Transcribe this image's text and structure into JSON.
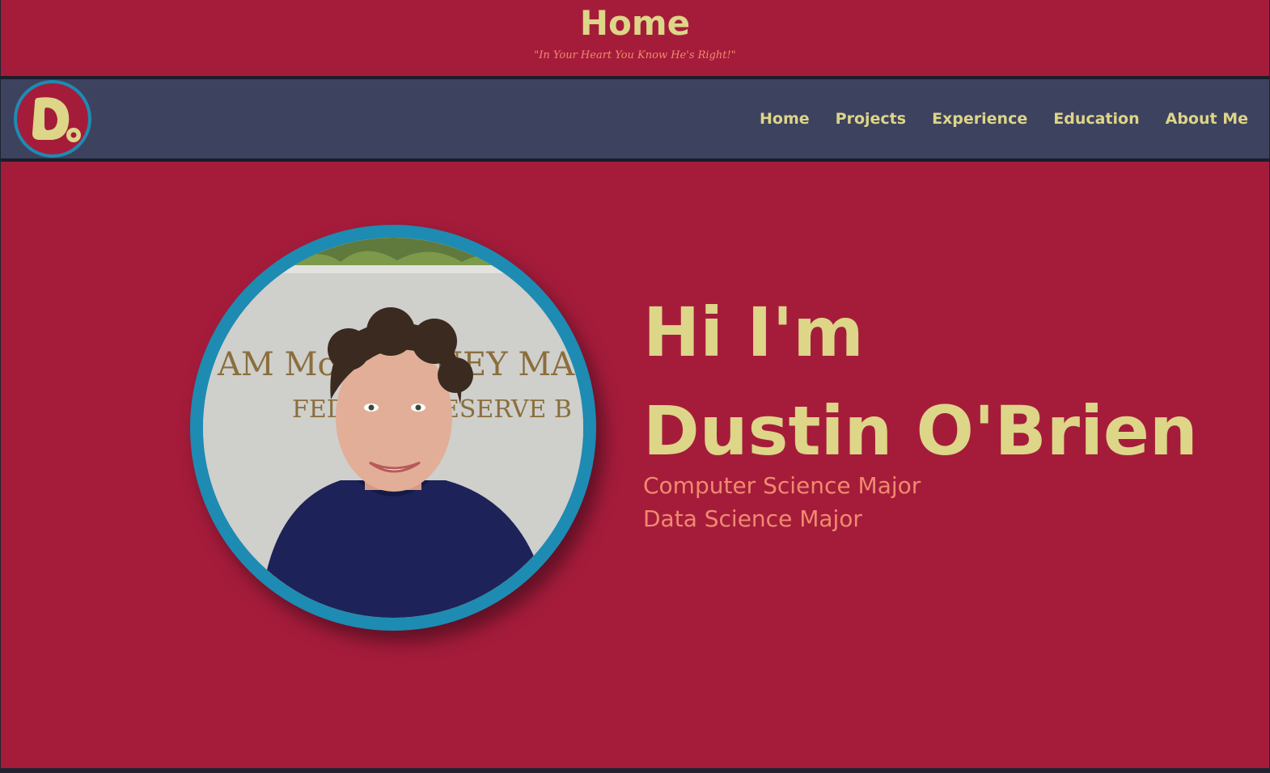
{
  "header": {
    "title": "Home",
    "tagline": "\"In Your Heart You Know He's Right!\""
  },
  "nav": {
    "logo_letter": "D",
    "items": [
      {
        "label": "Home"
      },
      {
        "label": "Projects"
      },
      {
        "label": "Experience"
      },
      {
        "label": "Education"
      },
      {
        "label": "About Me"
      }
    ]
  },
  "hero": {
    "greeting_line1": "Hi I'm",
    "greeting_line2": "Dustin O'Brien",
    "roles": [
      "Computer Science Major",
      "Data Science Major"
    ],
    "photo_sign_line1": "AM McCHESNEY MARTIN",
    "photo_sign_line2": "FEDERAL RESERVE B"
  },
  "colors": {
    "background": "#a51c3b",
    "navbar": "#3d425f",
    "accent_text": "#ddd588",
    "secondary_text": "#f08a6e",
    "ring": "#1e8bb3"
  },
  "icons": {
    "logo": "d-monogram-logo",
    "photo": "profile-photo"
  }
}
